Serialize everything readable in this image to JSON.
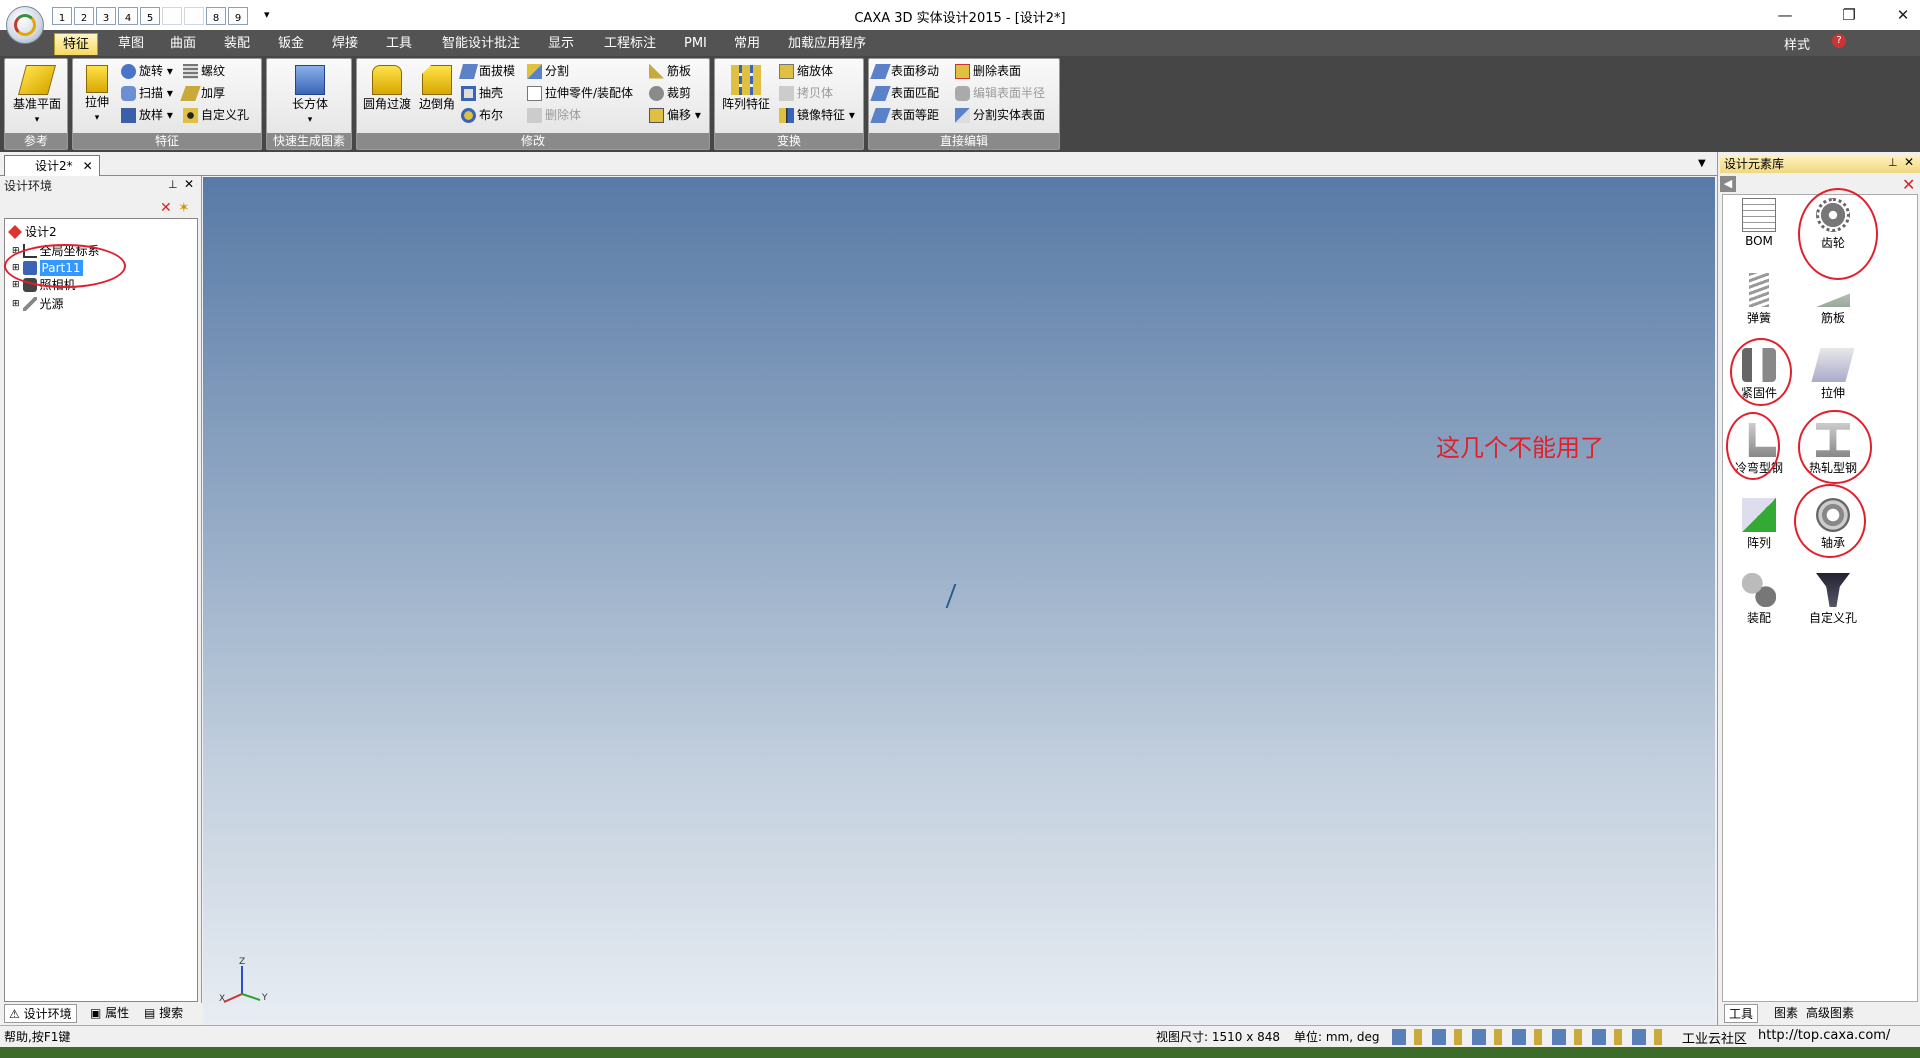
{
  "titlebar": {
    "title": "CAXA 3D 实体设计2015 - [设计2*]",
    "quick_access": [
      "1",
      "2",
      "3",
      "4",
      "5",
      "",
      "",
      "8",
      "9"
    ],
    "qa_more": "▾"
  },
  "menu": {
    "tabs": [
      "特征",
      "草图",
      "曲面",
      "装配",
      "钣金",
      "焊接",
      "工具",
      "智能设计批注",
      "显示",
      "工程标注",
      "PMI",
      "常用",
      "加载应用程序"
    ],
    "active": 0,
    "style_label": "样式"
  },
  "ribbon": {
    "ref": {
      "label": "参考",
      "btn": "基准平面"
    },
    "feature": {
      "label": "特征",
      "extrude": "拉伸",
      "rotate": "旋转",
      "scan": "扫描",
      "loft": "放样",
      "thread": "螺纹",
      "thicken": "加厚",
      "custom_hole": "自定义孔"
    },
    "quick": {
      "label": "快速生成图素",
      "box": "长方体"
    },
    "modify": {
      "label": "修改",
      "fillet": "圆角过渡",
      "chamfer": "边倒角",
      "draft": "面拔模",
      "shell": "抽壳",
      "boolean": "布尔",
      "split": "分割",
      "stretch": "拉伸零件/装配体",
      "delete": "删除体",
      "rib": "筋板",
      "trim": "裁剪",
      "offset": "偏移"
    },
    "transform": {
      "label": "变换",
      "pattern": "阵列特征",
      "scale": "缩放体",
      "copy": "拷贝体",
      "mirror": "镜像特征"
    },
    "direct": {
      "label": "直接编辑",
      "move": "表面移动",
      "match": "表面匹配",
      "equidist": "表面等距",
      "delete_face": "删除表面",
      "edit_radius": "编辑表面半径",
      "split_face": "分割实体表面"
    }
  },
  "doc": {
    "tab": "设计2*"
  },
  "left": {
    "title": "设计环境",
    "tree": [
      "设计2",
      "全局坐标系",
      "Part11",
      "照相机",
      "光源"
    ],
    "tabs": [
      "设计环境",
      "属性",
      "搜索"
    ]
  },
  "right": {
    "title": "设计元素库",
    "items": [
      "BOM",
      "齿轮",
      "弹簧",
      "筋板",
      "紧固件",
      "拉伸",
      "冷弯型钢",
      "热轧型钢",
      "阵列",
      "轴承",
      "装配",
      "自定义孔"
    ],
    "tabs": [
      "工具",
      "图素",
      "高级图素"
    ]
  },
  "annotation": "这几个不能用了",
  "status": {
    "help": "帮助,按F1键",
    "view_size": "视图尺寸: 1510 x 848",
    "units": "单位: mm, deg",
    "site": "工业云社区",
    "url": "http://top.caxa.com/"
  },
  "axes": {
    "z": "Z",
    "x": "X",
    "y": "Y"
  },
  "colors": {
    "annotation_red": "#e0202c",
    "ribbon_dark": "#464646",
    "menu_dark": "#535353"
  }
}
